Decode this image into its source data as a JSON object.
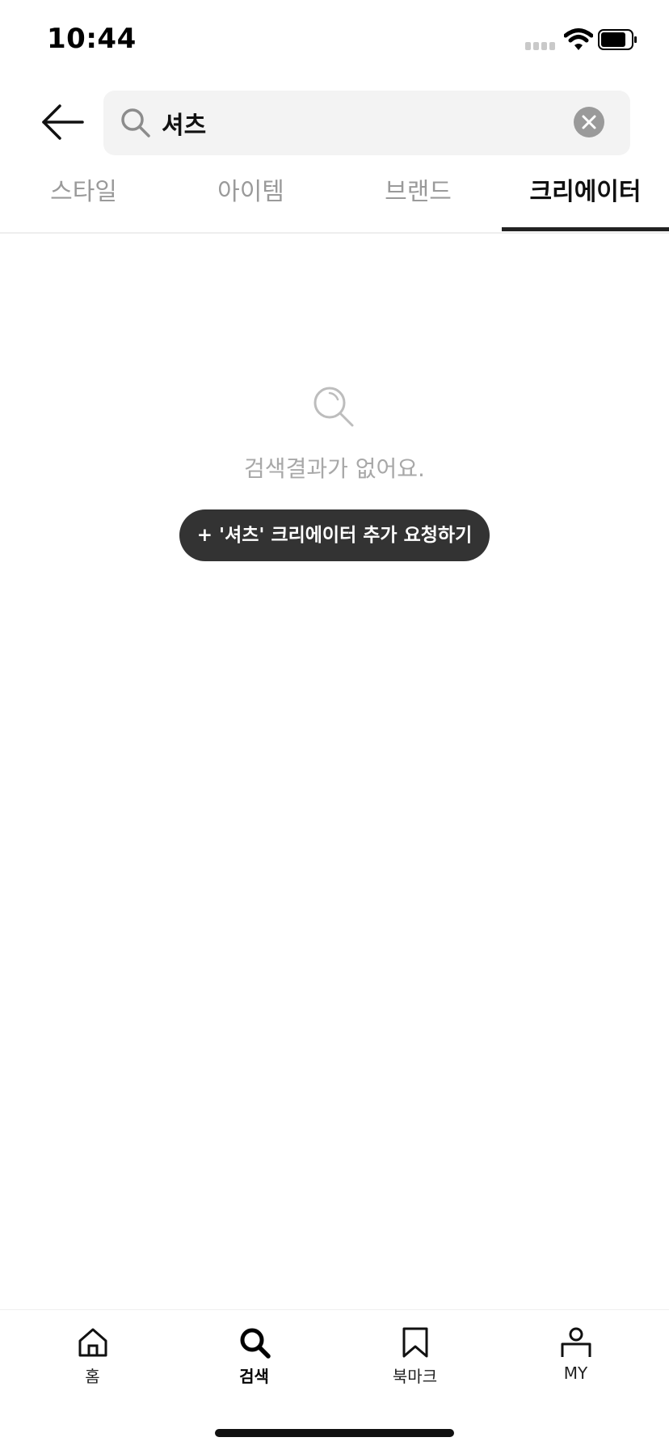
{
  "status_bar": {
    "time": "10:44"
  },
  "search": {
    "query": "셔츠"
  },
  "tabs": [
    {
      "label": "스타일",
      "active": false
    },
    {
      "label": "아이템",
      "active": false
    },
    {
      "label": "브랜드",
      "active": false
    },
    {
      "label": "크리에이터",
      "active": true
    }
  ],
  "empty_state": {
    "message": "검색결과가 없어요.",
    "request_button": "+ '셔츠' 크리에이터 추가 요청하기"
  },
  "bottom_nav": {
    "items": [
      {
        "label": "홈",
        "icon": "home-icon",
        "active": false
      },
      {
        "label": "검색",
        "icon": "search-icon",
        "active": true
      },
      {
        "label": "북마크",
        "icon": "bookmark-icon",
        "active": false
      },
      {
        "label": "MY",
        "icon": "person-icon",
        "active": false
      }
    ]
  },
  "colors": {
    "accent": "#222222",
    "inactive_text": "#9a9a9a",
    "button_bg": "#333333",
    "search_bg": "#f3f3f3"
  }
}
